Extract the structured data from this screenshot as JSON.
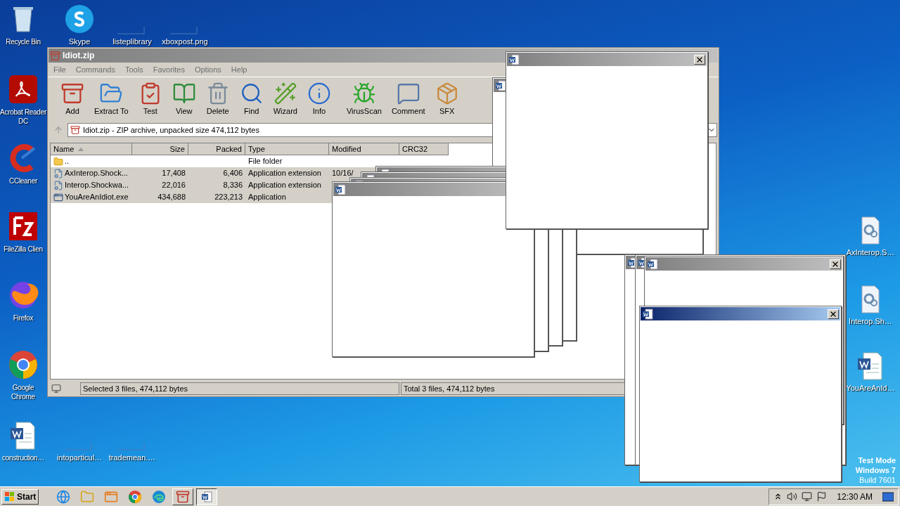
{
  "desktop_icons": [
    {
      "label": "Recycle Bin"
    },
    {
      "label": "Skype"
    },
    {
      "label": "listeplibrary"
    },
    {
      "label": "xboxpost.png"
    },
    {
      "label": "Acrobat Reader DC"
    },
    {
      "label": "CCleaner"
    },
    {
      "label": "FileZilla Clien"
    },
    {
      "label": "Firefox"
    },
    {
      "label": "Google Chrome"
    },
    {
      "label": "construction…"
    },
    {
      "label": "intoparticul…"
    },
    {
      "label": "trademean.…"
    },
    {
      "label": "AxInterop.S…"
    },
    {
      "label": "Interop.Sh…"
    },
    {
      "label": "YouAreAnId…"
    }
  ],
  "system_text": [
    "Test Mode",
    "Windows 7",
    "Build 7601"
  ],
  "winrar": {
    "title": "Idiot.zip",
    "menu": [
      "File",
      "Commands",
      "Tools",
      "Favorites",
      "Options",
      "Help"
    ],
    "toolbar": [
      "Add",
      "Extract To",
      "Test",
      "View",
      "Delete",
      "Find",
      "Wizard",
      "Info",
      "VirusScan",
      "Comment",
      "SFX"
    ],
    "address": "Idiot.zip - ZIP archive, unpacked size 474,112 bytes",
    "columns": [
      {
        "label": "Name",
        "sorted": true
      },
      {
        "label": "Size",
        "sorted": false
      },
      {
        "label": "Packed",
        "sorted": false
      },
      {
        "label": "Type",
        "sorted": false
      },
      {
        "label": "Modified",
        "sorted": false
      },
      {
        "label": "CRC32",
        "sorted": false
      }
    ],
    "rows": [
      {
        "kind": "folder",
        "name": "..",
        "type": "File folder",
        "selected": false
      },
      {
        "kind": "dll",
        "name": "AxInterop.Shock...",
        "size": "17,408",
        "packed": "6,406",
        "type": "Application extension",
        "modified": "10/16/",
        "selected": true
      },
      {
        "kind": "dll",
        "name": "Interop.Shockwa...",
        "size": "22,016",
        "packed": "8,336",
        "type": "Application extension",
        "selected": true
      },
      {
        "kind": "exe",
        "name": "YouAreAnIdiot.exe",
        "size": "434,688",
        "packed": "223,213",
        "type": "Application",
        "selected": true
      }
    ],
    "status_left": "Selected 3 files, 474,112 bytes",
    "status_right": "Total 3 files, 474,112 bytes"
  },
  "popups": [
    {
      "active": false
    },
    {
      "active": false
    },
    {
      "active": false
    },
    {
      "active": false
    },
    {
      "active": false
    },
    {
      "active": false
    },
    {
      "active": false
    },
    {
      "active": false
    },
    {
      "active": false
    },
    {
      "active": true
    }
  ],
  "taskbar": {
    "start": "Start",
    "apps": [
      {
        "selected": false
      },
      {
        "selected": false
      },
      {
        "selected": false
      },
      {
        "selected": false
      },
      {
        "selected": false
      },
      {
        "selected": false
      },
      {
        "selected": true
      }
    ],
    "clock": "12:30 AM"
  }
}
